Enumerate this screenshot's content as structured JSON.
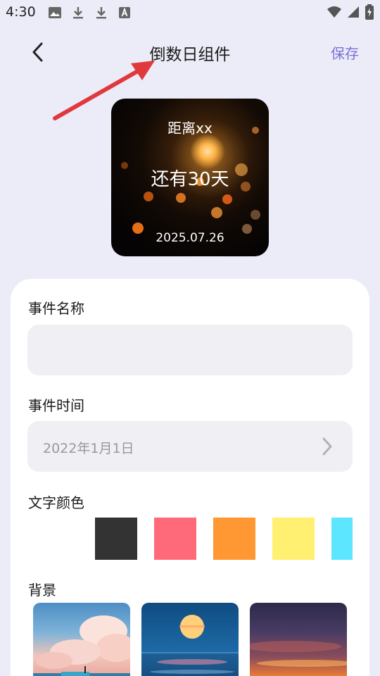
{
  "status_bar": {
    "time": "4:30",
    "icons": [
      "image-icon",
      "download-icon",
      "download-icon",
      "text-a-icon",
      "wifi-icon",
      "signal-icon",
      "battery-icon"
    ]
  },
  "header": {
    "title": "倒数日组件",
    "save_label": "保存"
  },
  "preview": {
    "label": "距离xx",
    "countdown": "还有30天",
    "date": "2025.07.26"
  },
  "form": {
    "event_name_label": "事件名称",
    "event_name_value": "",
    "event_time_label": "事件时间",
    "event_time_value": "2022年1月1日",
    "text_color_label": "文字颜色",
    "text_colors": [
      "#333333",
      "#ff6a7b",
      "#ff9833",
      "#fff072",
      "#5ce6ff"
    ],
    "background_label": "背景",
    "backgrounds": [
      "clouds-sea",
      "sunset-ocean",
      "dusk-sky"
    ]
  },
  "colors": {
    "accent": "#7a72d8",
    "page_bg": "#ececf8",
    "annotation": "#e0393d"
  }
}
